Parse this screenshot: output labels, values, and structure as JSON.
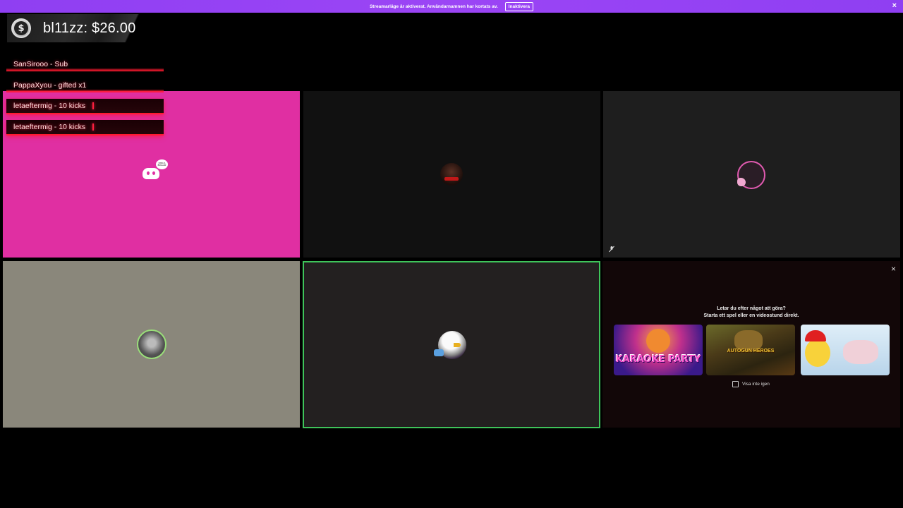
{
  "banner": {
    "text": "Streamarläge är aktiverat. Användarnamnen har kortats av.",
    "button_label": "Inaktivera",
    "close_label": "×"
  },
  "donation": {
    "coin_symbol": "$",
    "text": "bl11zz: $26.00"
  },
  "alerts": [
    {
      "text": "SanSirooo - Sub"
    },
    {
      "text": "PappaXyou - gifted x1"
    },
    {
      "text": "letaeftermig - 10 kicks"
    },
    {
      "text": "letaeftermig - 10 kicks"
    }
  ],
  "tiles": {
    "discord_bubble": "DISC A BOLLAR",
    "colors": {
      "pink": "#e02fa2",
      "dark1": "#111111",
      "dark2": "#1e1e1e",
      "gray": "#8a877b",
      "dark3": "#232020",
      "speaking_border": "#3ec45a"
    }
  },
  "activity": {
    "close_label": "×",
    "title_line1": "Letar du efter något att göra?",
    "title_line2": "Starta ett spel eller en videostund direkt.",
    "cards": [
      {
        "name": "Karaoke Party",
        "text": "KARAOKE PARTY"
      },
      {
        "name": "Autogun Heroes",
        "text": "AUTOGUN HEROES"
      },
      {
        "name": "Chicken game",
        "text": ""
      }
    ],
    "checkbox_label": "Visa inte igen"
  }
}
